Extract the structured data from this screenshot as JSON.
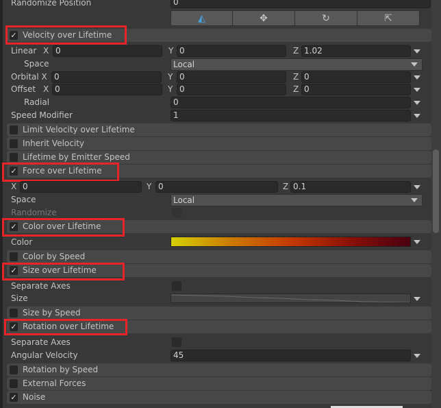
{
  "shape": {
    "randomize_position_label": "Randomize Position",
    "randomize_position_value": "0"
  },
  "toolbar": {
    "icons": [
      "cone-gizmo-icon",
      "move-icon",
      "rotate-icon",
      "scale-icon"
    ]
  },
  "velocity": {
    "title": "Velocity over Lifetime",
    "checked": true,
    "linear_label": "Linear",
    "x": "X",
    "y": "Y",
    "z": "Z",
    "linear_x": "0",
    "linear_y": "0",
    "linear_z": "1.02",
    "space_label": "Space",
    "space_value": "Local",
    "orbital_label": "Orbital X",
    "orbital_x": "0",
    "orbital_y": "0",
    "orbital_z": "0",
    "offset_label": "Offset",
    "offset_x": "0",
    "offset_y": "0",
    "offset_z": "0",
    "radial_label": "Radial",
    "radial_value": "0",
    "speed_label": "Speed Modifier",
    "speed_value": "1"
  },
  "modules": {
    "limit_velocity": "Limit Velocity over Lifetime",
    "inherit_velocity": "Inherit Velocity",
    "lifetime_emitter": "Lifetime by Emitter Speed",
    "color_by_speed": "Color by Speed",
    "size_by_speed": "Size by Speed",
    "rotation_by_speed": "Rotation by Speed",
    "external_forces": "External Forces",
    "noise": "Noise"
  },
  "force": {
    "title": "Force over Lifetime",
    "checked": true,
    "x_label": "X",
    "y_label": "Y",
    "z_label": "Z",
    "x": "0",
    "y": "0",
    "z": "0.1",
    "space_label": "Space",
    "space_value": "Local",
    "randomize_label": "Randomize"
  },
  "color": {
    "title": "Color over Lifetime",
    "checked": true,
    "color_label": "Color",
    "gradient": [
      "#d4d000",
      "#cc7a00",
      "#c43a00",
      "#8a1008",
      "#4a0010"
    ]
  },
  "size": {
    "title": "Size over Lifetime",
    "checked": true,
    "separate_axes_label": "Separate Axes",
    "size_label": "Size"
  },
  "rotation": {
    "title": "Rotation over Lifetime",
    "checked": true,
    "separate_axes_label": "Separate Axes",
    "angular_label": "Angular Velocity",
    "angular_value": "45"
  },
  "highlight_color": "#e8232a"
}
